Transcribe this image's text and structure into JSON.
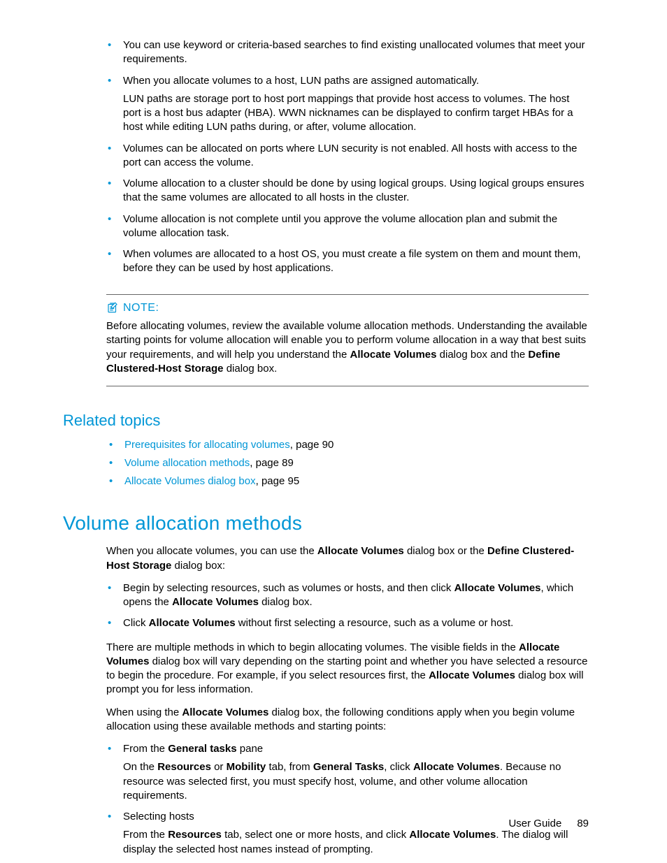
{
  "top_bullets": [
    {
      "text": "You can use keyword or criteria-based searches to find existing unallocated volumes that meet your requirements."
    },
    {
      "text": "When you allocate volumes to a host, LUN paths are assigned automatically.",
      "sub": "LUN paths are storage port to host port mappings that provide host access to volumes. The host port is a host bus adapter (HBA). WWN nicknames can be displayed to confirm target HBAs for a host while editing LUN paths during, or after, volume allocation."
    },
    {
      "text": "Volumes can be allocated on ports where LUN security is not enabled. All hosts with access to the port can access the volume."
    },
    {
      "text": "Volume allocation to a cluster should be done by using logical groups. Using logical groups ensures that the same volumes are allocated to all hosts in the cluster."
    },
    {
      "text": "Volume allocation is not complete until you approve the volume allocation plan and submit the volume allocation task."
    },
    {
      "text": "When volumes are allocated to a host OS, you must create a file system on them and mount them, before they can be used by host applications."
    }
  ],
  "note": {
    "label": "NOTE:",
    "pre": "Before allocating volumes, review the available volume allocation methods. Understanding the available starting points for volume allocation will enable you to perform volume allocation in a way that best suits your requirements, and will help you understand the ",
    "bold1": "Allocate Volumes",
    "mid1": " dialog box and the ",
    "bold2": "Define Clustered-Host Storage",
    "tail": " dialog box."
  },
  "related": {
    "heading": "Related topics",
    "items": [
      {
        "link": "Prerequisites for allocating volumes",
        "suffix": ", page 90"
      },
      {
        "link": "Volume allocation methods",
        "suffix": ", page 89"
      },
      {
        "link": "Allocate Volumes dialog box",
        "suffix": ", page 95"
      }
    ]
  },
  "sec2": {
    "heading": "Volume allocation methods",
    "p1_pre": "When you allocate volumes, you can use the ",
    "p1_b1": "Allocate Volumes",
    "p1_mid": " dialog box or the ",
    "p1_b2": "Define Clustered-Host Storage",
    "p1_tail": " dialog box:",
    "b1_pre": "Begin by selecting resources, such as volumes or hosts, and then click ",
    "b1_b1": "Allocate Volumes",
    "b1_mid": ", which opens the ",
    "b1_b2": "Allocate Volumes",
    "b1_tail": " dialog box.",
    "b2_pre": "Click ",
    "b2_b1": "Allocate Volumes",
    "b2_tail": " without first selecting a resource, such as a volume or host.",
    "p2_pre": "There are multiple methods in which to begin allocating volumes. The visible fields in the ",
    "p2_b1": "Allocate Volumes",
    "p2_mid": " dialog box will vary depending on the starting point and whether you have selected a resource to begin the procedure. For example, if you select resources first, the ",
    "p2_b2": "Allocate Volumes",
    "p2_tail": " dialog box will prompt you for less information.",
    "p3_pre": "When using the ",
    "p3_b1": "Allocate Volumes",
    "p3_tail": " dialog box, the following conditions apply when you begin volume allocation using these available methods and starting points:",
    "c1_pre": "From the ",
    "c1_b1": "General tasks",
    "c1_tail": " pane",
    "c1d_pre": "On the ",
    "c1d_b1": "Resources",
    "c1d_m1": " or ",
    "c1d_b2": "Mobility",
    "c1d_m2": " tab, from ",
    "c1d_b3": "General Tasks",
    "c1d_m3": ", click ",
    "c1d_b4": "Allocate Volumes",
    "c1d_tail": ". Because no resource was selected first, you must specify host, volume, and other volume allocation requirements.",
    "c2_head": "Selecting hosts",
    "c2d_pre": "From the ",
    "c2d_b1": "Resources",
    "c2d_m1": " tab, select one or more hosts, and click ",
    "c2d_b2": "Allocate Volumes",
    "c2d_tail": ". The dialog will display the selected host names instead of prompting."
  },
  "footer": {
    "label": "User Guide",
    "page": "89"
  }
}
